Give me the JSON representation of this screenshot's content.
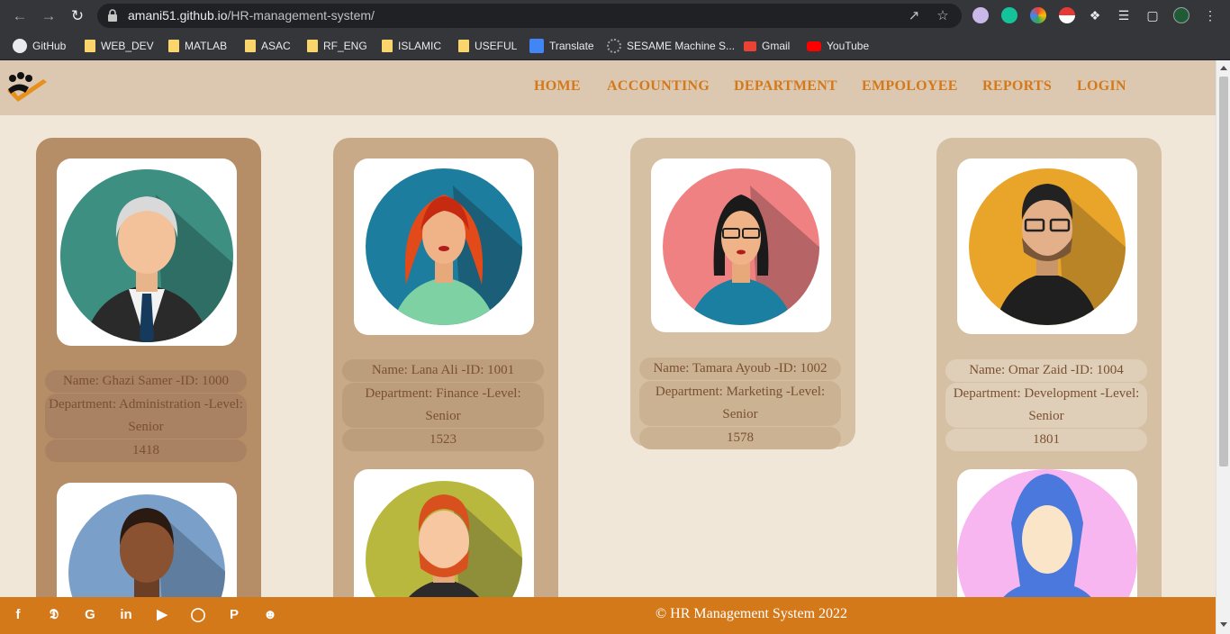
{
  "browser": {
    "url_host": "amani51.github.io",
    "url_path": "/HR-management-system/",
    "bookmarks": [
      "GitHub",
      "WEB_DEV",
      "MATLAB",
      "ASAC",
      "RF_ENG",
      "ISLAMIC",
      "USEFUL",
      "Translate",
      "SESAME Machine S...",
      "Gmail",
      "YouTube"
    ]
  },
  "nav": {
    "items": [
      "HOME",
      "ACCOUNTING",
      "DEPARTMENT",
      "EMPOLOYEE",
      "REPORTS",
      "LOGIN"
    ]
  },
  "employees": [
    {
      "name_line": "Name: Ghazi Samer -ID: 1000",
      "dept_line": "Department: Administration -Level: Senior",
      "salary": "1418"
    },
    {
      "name_line": "Name: Lana Ali -ID: 1001",
      "dept_line": "Department: Finance -Level: Senior",
      "salary": "1523"
    },
    {
      "name_line": "Name: Tamara Ayoub -ID: 1002",
      "dept_line": "Department: Marketing -Level: Senior",
      "salary": "1578"
    },
    {
      "name_line": "Name: Omar Zaid -ID: 1004",
      "dept_line": "Department: Development -Level: Senior",
      "salary": "1801"
    }
  ],
  "footer": {
    "copyright": "© HR Management System 2022",
    "social_icons": [
      "facebook-icon",
      "twitter-icon",
      "google-icon",
      "linkedin-icon",
      "youtube-icon",
      "instagram-icon",
      "pinterest-icon",
      "snapchat-icon"
    ]
  },
  "colors": {
    "accent": "#d4791a",
    "header_bg": "#dcc8b0",
    "page_bg": "#f1e7d9"
  }
}
